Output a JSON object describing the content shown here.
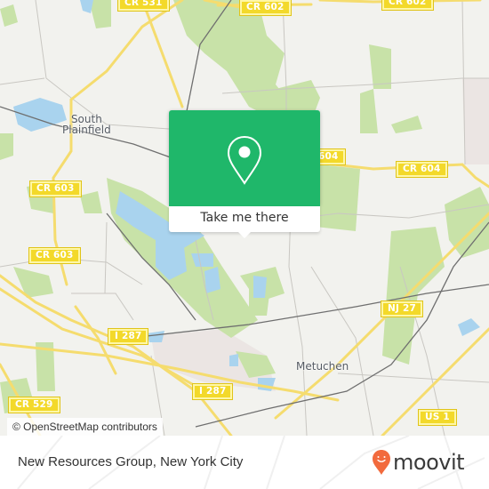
{
  "map": {
    "place_labels": [
      {
        "id": "south-plainfield",
        "lines": [
          "South",
          "Plainfield"
        ]
      },
      {
        "id": "metuchen",
        "lines": [
          "Metuchen"
        ]
      }
    ],
    "road_shields": [
      {
        "id": "cr531",
        "label": "CR 531"
      },
      {
        "id": "cr602-a",
        "label": "CR 602"
      },
      {
        "id": "cr602-b",
        "label": "CR 602"
      },
      {
        "id": "cr604-a",
        "label": "604"
      },
      {
        "id": "cr604-b",
        "label": "CR 604"
      },
      {
        "id": "cr603-a",
        "label": "CR 603"
      },
      {
        "id": "cr603-b",
        "label": "CR 603"
      },
      {
        "id": "nj27",
        "label": "NJ 27"
      },
      {
        "id": "i287-a",
        "label": "I 287"
      },
      {
        "id": "i287-b",
        "label": "I 287"
      },
      {
        "id": "cr529",
        "label": "CR 529"
      },
      {
        "id": "us1",
        "label": "US 1"
      }
    ],
    "attribution": "© OpenStreetMap contributors",
    "colors": {
      "land": "#f2f2ee",
      "park": "#c8e2a8",
      "water": "#a9d3ee",
      "road_major": "#f5dc6e",
      "rail": "#6f6f6f",
      "industrial": "#ebe5e3"
    }
  },
  "popup": {
    "icon": "location-pin-icon",
    "cta_label": "Take me there",
    "accent_color": "#1fb76a"
  },
  "footer": {
    "title": "New Resources Group, New York City",
    "brand": "moovit",
    "brand_color": "#f26a3d"
  }
}
